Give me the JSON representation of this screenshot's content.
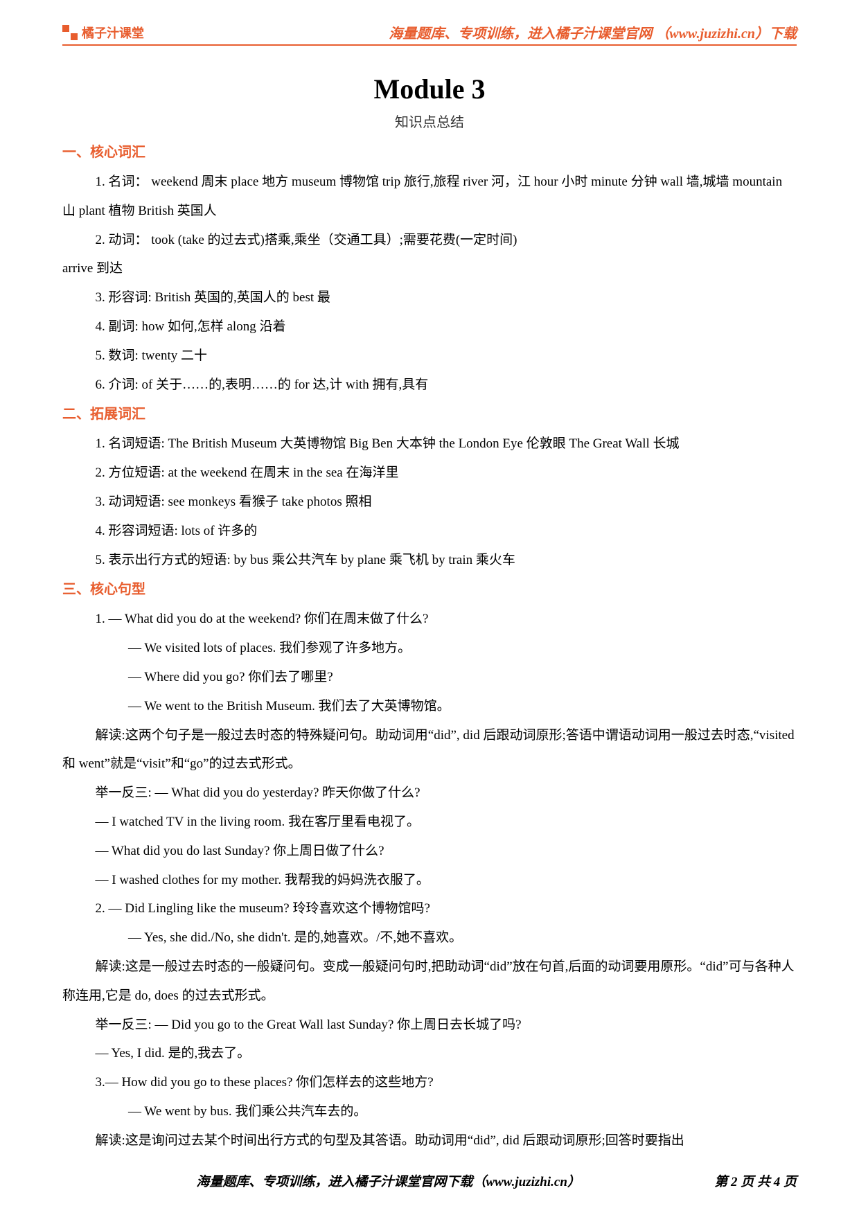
{
  "header": {
    "logo_text": "橘子汁课堂",
    "right": "海量题库、专项训练，进入橘子汁课堂官网 （www.juzizhi.cn）下载"
  },
  "title": "Module 3",
  "subtitle": "知识点总结",
  "s1": {
    "heading": "一、核心词汇",
    "p1": "1. 名词：  weekend 周末     place 地方     museum 博物馆     trip 旅行,旅程     river 河，江     hour 小时 minute 分钟     wall 墙,城墙     mountain 山     plant 植物     British 英国人",
    "p2": "2. 动词：  took (take 的过去式)搭乘,乘坐（交通工具）;需要花费(一定时间)",
    "p2b": " arrive 到达",
    "p3": "3. 形容词: British 英国的,英国人的    best 最",
    "p4": "4. 副词: how 如何,怎样     along 沿着",
    "p5": "5. 数词: twenty  二十",
    "p6": "6. 介词: of 关于……的,表明……的    for 达,计    with 拥有,具有"
  },
  "s2": {
    "heading": "二、拓展词汇",
    "p1": "1. 名词短语: The British Museum  大英博物馆     Big Ben  大本钟     the London Eye 伦敦眼     The Great Wall  长城",
    "p2": "2. 方位短语: at the weekend  在周末     in the sea  在海洋里",
    "p3": "3. 动词短语: see monkeys 看猴子     take photos  照相",
    "p4": " 4. 形容词短语: lots of  许多的",
    "p5": "5. 表示出行方式的短语: by bus  乘公共汽车     by plane  乘飞机    by train  乘火车"
  },
  "s3": {
    "heading": "三、核心句型",
    "q1a": "1.  — What did you do at the weekend?  你们在周末做了什么?",
    "q1b": "— We visited lots of places.  我们参观了许多地方。",
    "q1c": "— Where did you go?  你们去了哪里?",
    "q1d": "— We went to the British Museum.  我们去了大英博物馆。",
    "e1": "解读:这两个句子是一般过去时态的特殊疑问句。助动词用“did”, did 后跟动词原形;答语中谓语动词用一般过去时态,“visited 和 went”就是“visit”和“go”的过去式形式。",
    "ex1a": "举一反三:  — What did you do yesterday?  昨天你做了什么?",
    "ex1b": "— I watched TV in the living room.  我在客厅里看电视了。",
    "ex1c": "— What did you do last Sunday?  你上周日做了什么?",
    "ex1d": "— I washed clothes for my mother.  我帮我的妈妈洗衣服了。",
    "q2a": "2.  — Did Lingling like the museum?  玲玲喜欢这个博物馆吗?",
    "q2b": "— Yes, she did./No, she didn't.  是的,她喜欢。/不,她不喜欢。",
    "e2": "解读:这是一般过去时态的一般疑问句。变成一般疑问句时,把助动词“did”放在句首,后面的动词要用原形。“did”可与各种人称连用,它是 do, does 的过去式形式。",
    "ex2a": "举一反三:  — Did you go to the Great Wall last Sunday?  你上周日去长城了吗?",
    "ex2b": "— Yes, I did.  是的,我去了。",
    "q3a": "3.— How did you go to these places?  你们怎样去的这些地方?",
    "q3b": "— We went by bus.  我们乘公共汽车去的。",
    "e3": "解读:这是询问过去某个时间出行方式的句型及其答语。助动词用“did”, did 后跟动词原形;回答时要指出"
  },
  "footer": {
    "left": "海量题库、专项训练，进入橘子汁课堂官网下载（www.juzizhi.cn）",
    "right": "第 2 页 共 4 页"
  }
}
